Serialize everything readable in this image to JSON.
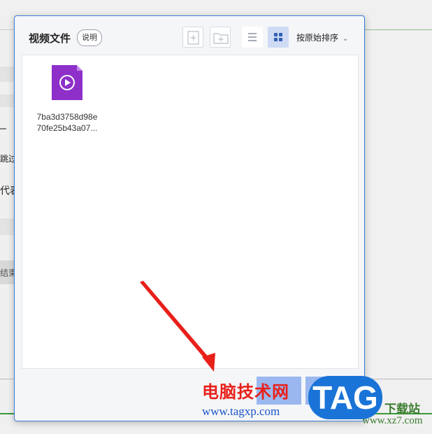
{
  "background": {
    "side_texts": [
      "跳过",
      "代表",
      "结束"
    ]
  },
  "dialog": {
    "title": "视频文件",
    "help_label": "说明",
    "toolbar": {
      "new_file_icon": "add-file-icon",
      "new_folder_icon": "add-folder-icon",
      "list_view_icon": "list-view-icon",
      "grid_view_icon": "grid-view-icon",
      "active_view": "grid",
      "sort_label": "按原始排序"
    },
    "files": [
      {
        "name_line1": "7ba3d3758d98e",
        "name_line2": "70fe25b43a07...",
        "icon": "video-file-icon"
      }
    ]
  },
  "watermark": {
    "site_name": "电脑技术网",
    "site_url": "www.tagxp.com",
    "badge": "TAG",
    "right_text": "下载站",
    "right_url": "www.xz7.com"
  },
  "colors": {
    "accent": "#3a7bd5",
    "file_icon": "#8e2fc9",
    "watermark_red": "#e8201a",
    "watermark_blue": "#1a74d8"
  }
}
